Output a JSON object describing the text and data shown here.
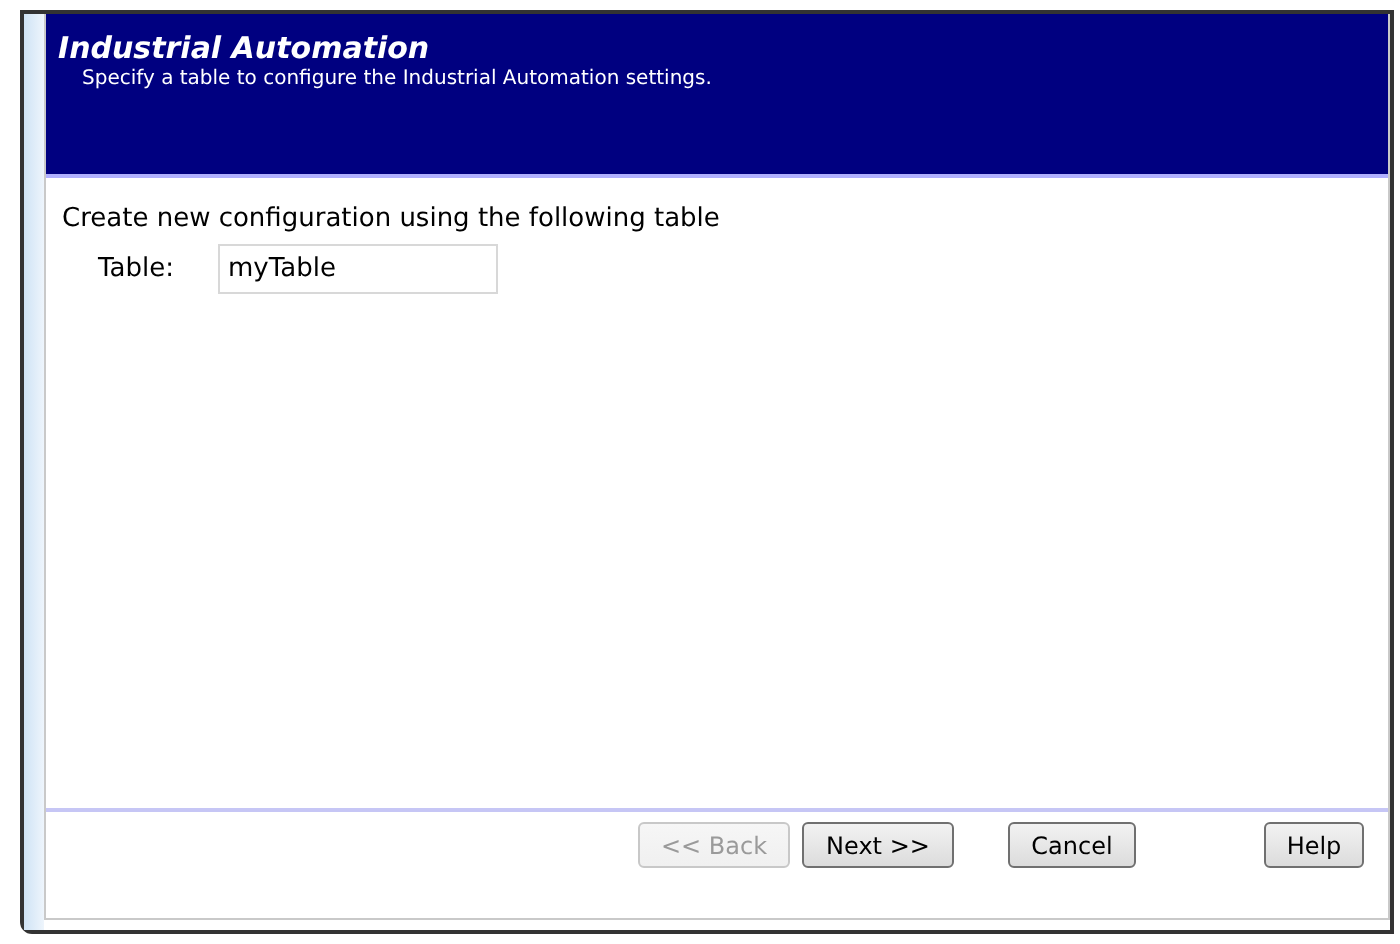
{
  "header": {
    "title": "Industrial Automation",
    "subtitle": "Specify a table to configure the Industrial Automation settings."
  },
  "body": {
    "instruction": "Create new configuration using the following table",
    "field": {
      "label": "Table:",
      "value": "myTable"
    }
  },
  "buttons": [
    {
      "label": "<< Back",
      "disabled": true,
      "kind": "nav"
    },
    {
      "label": "Next >>",
      "disabled": false,
      "kind": "nav"
    },
    {
      "label": "Cancel",
      "disabled": false,
      "kind": "cancel"
    },
    {
      "label": "Help",
      "disabled": false,
      "kind": "help"
    }
  ]
}
